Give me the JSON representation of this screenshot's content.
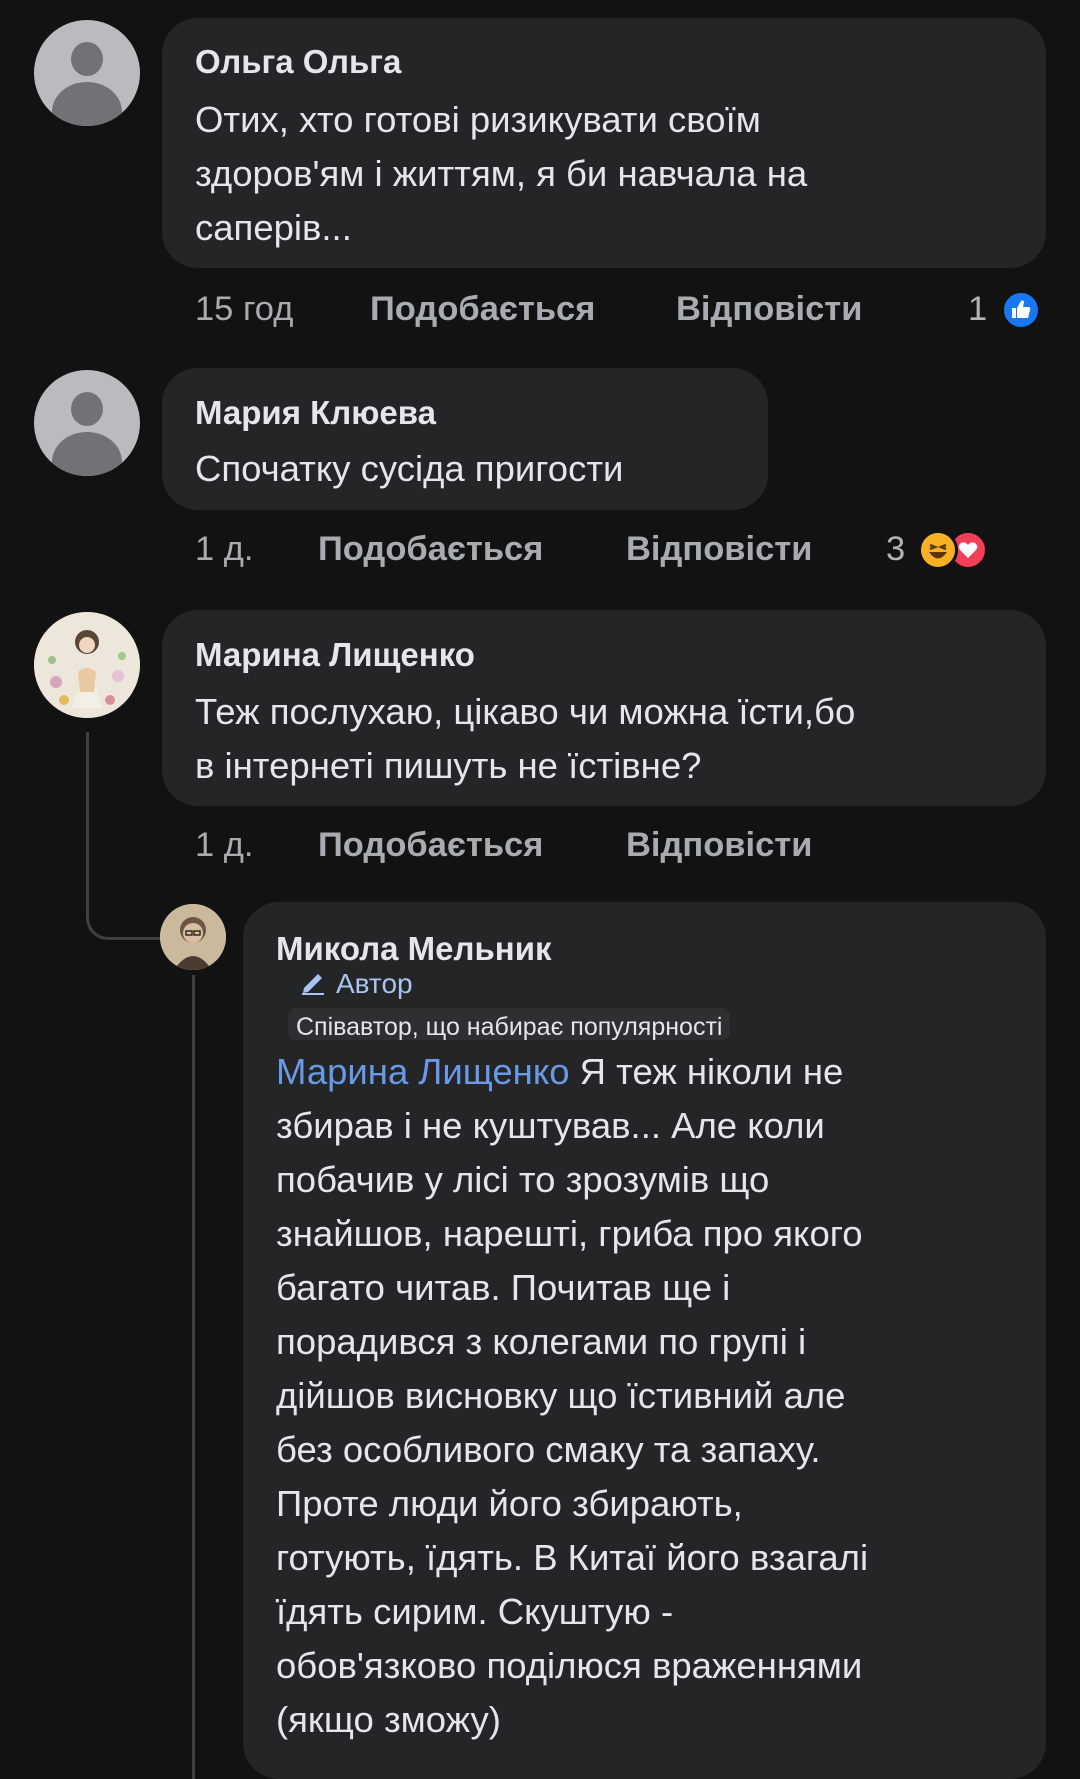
{
  "comments": [
    {
      "author": "Ольга Ольга",
      "lines": [
        "Отих, хто готові ризикувати своїм",
        "здоров'ям і життям, я би  навчала на",
        "саперів..."
      ],
      "time": "15 год",
      "like_label": "Подобається",
      "reply_label": "Відповісти",
      "reaction_count": "1",
      "reaction_icons": [
        "like-icon"
      ]
    },
    {
      "author": "Мария Клюева",
      "lines": [
        "Спочатку сусіда  пригости"
      ],
      "time": "1 д.",
      "like_label": "Подобається",
      "reply_label": "Відповісти",
      "reaction_count": "3",
      "reaction_icons": [
        "haha-icon",
        "love-icon"
      ]
    },
    {
      "author": "Марина Лищенко",
      "lines": [
        "Теж послухаю, цікаво чи можна їсти,бо",
        "в інтернеті пишуть не їстівне?"
      ],
      "time": "1 д.",
      "like_label": "Подобається",
      "reply_label": "Відповісти"
    }
  ],
  "reply": {
    "author": "Микола Мельник",
    "author_badge": "Автор",
    "secondary_badge": "Співавтор, що набирає популярності",
    "mention": "Марина Лищенко",
    "lines": [
      " Я теж ніколи не",
      "збирав і не куштував... Але коли",
      "побачив у лісі то зрозумів що",
      "знайшов, нарешті, гриба про якого",
      "багато читав. Почитав ще і",
      "порадився з колегами по групі і",
      "дійшов висновку що їстивний але",
      "без особливого  смаку та запаху.",
      "Проте люди його збирають,",
      "готують, їдять. В Китаї його взагалі",
      "їдять сирим. Скуштую -",
      "обов'язково поділюся враженнями",
      "(якщо зможу)"
    ]
  },
  "colors": {
    "background": "#121212",
    "bubble": "#242526",
    "mention": "#6a99e6",
    "like_blue": "#1877f2",
    "love_red": "#f33e58",
    "haha_yellow": "#f7b125"
  }
}
